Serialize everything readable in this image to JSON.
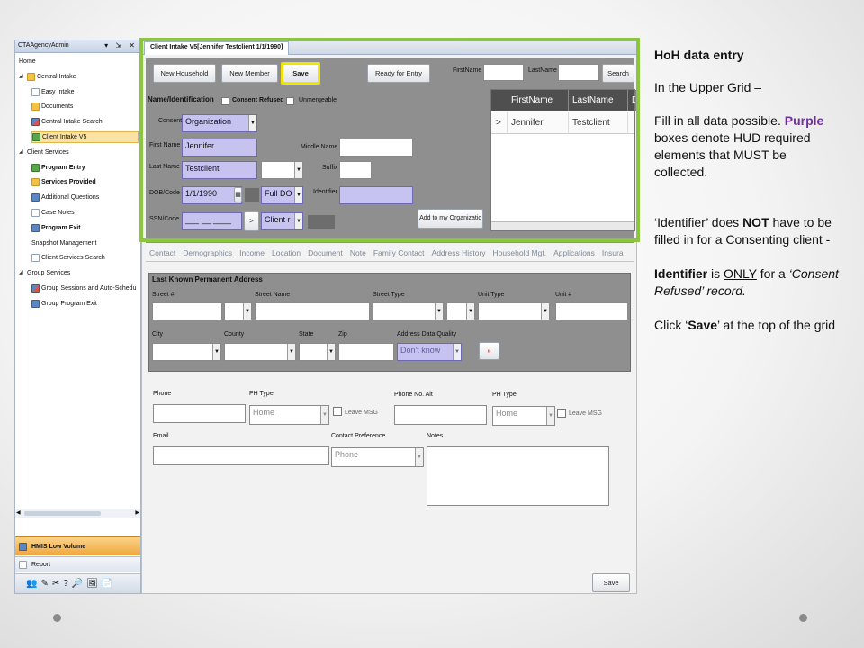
{
  "nav": {
    "title": "CTAAgencyAdmin",
    "controls": "▾ ⇲ ✕",
    "items": [
      {
        "label": "Home",
        "level": 0,
        "icon": "none",
        "bold": false
      },
      {
        "label": "Central Intake",
        "level": 0,
        "icon": "folder",
        "bold": false,
        "expanded": true
      },
      {
        "label": "Easy Intake",
        "level": 1,
        "icon": "page",
        "bold": false
      },
      {
        "label": "Documents",
        "level": 1,
        "icon": "folder",
        "bold": false
      },
      {
        "label": "Central Intake Search",
        "level": 1,
        "icon": "mixed",
        "bold": false
      },
      {
        "label": "Client Intake V5",
        "level": 1,
        "icon": "green",
        "bold": false,
        "selected": true
      },
      {
        "label": "Client Services",
        "level": 0,
        "icon": "none",
        "bold": false,
        "expanded": true
      },
      {
        "label": "Program Entry",
        "level": 1,
        "icon": "green",
        "bold": true
      },
      {
        "label": "Services Provided",
        "level": 1,
        "icon": "folder",
        "bold": true
      },
      {
        "label": "Additional Questions",
        "level": 1,
        "icon": "blue",
        "bold": false
      },
      {
        "label": "Case Notes",
        "level": 1,
        "icon": "page",
        "bold": false
      },
      {
        "label": "Program Exit",
        "level": 1,
        "icon": "blue",
        "bold": true
      },
      {
        "label": "Snapshot Management",
        "level": 1,
        "icon": "none",
        "bold": false
      },
      {
        "label": "Client Services Search",
        "level": 1,
        "icon": "page",
        "bold": false
      },
      {
        "label": "Group Services",
        "level": 0,
        "icon": "none",
        "bold": false,
        "expanded": true
      },
      {
        "label": "Group Sessions and Auto-Schedu",
        "level": 1,
        "icon": "mixed",
        "bold": false
      },
      {
        "label": "Group Program Exit",
        "level": 1,
        "icon": "blue",
        "bold": false
      }
    ],
    "bottom_buttons": [
      {
        "label": "HMIS Low Volume",
        "icon": "people-icon"
      },
      {
        "label": "Report",
        "icon": "report-icon"
      }
    ],
    "tool_icons": [
      "👥",
      "✎",
      "✂",
      "?",
      "🔎",
      "🖼",
      "📄"
    ]
  },
  "window": {
    "tab_title": "Client Intake V5[Jennifer Testclient 1/1/1990]",
    "toolbar": {
      "new_household": "New Household",
      "new_member": "New Member",
      "save": "Save",
      "ready_for_entry": "Ready for Entry",
      "firstname_label": "FirstName",
      "lastname_label": "LastName",
      "search": "Search"
    },
    "name_section": {
      "title": "Name/Identification",
      "consent_refused": "Consent Refused",
      "unmergeable": "Unmergeable",
      "consent_label": "Consent",
      "consent_value": "Organization",
      "first_name_label": "First Name",
      "first_name_value": "Jennifer",
      "middle_name_label": "Middle Name",
      "last_name_label": "Last Name",
      "last_name_value": "Testclient",
      "suffix_label": "Suffix",
      "dob_label": "DOB/Code",
      "dob_value": "1/1/1990",
      "dob_code_value": "Full DO",
      "identifier_label": "Identifier",
      "ssn_label": "SSN/Code",
      "ssn_value": "___-__-____",
      "ssn_arrow": ">",
      "ssn_code_value": "Client r",
      "add_to_org": "Add to my Organizatic"
    },
    "grid": {
      "columns": [
        "FirstName",
        "LastName",
        "DO"
      ],
      "rows": [
        {
          "arrow": ">",
          "first": "Jennifer",
          "last": "Testclient",
          "dob": ""
        }
      ]
    },
    "sub_tabs": [
      "Contact",
      "Demographics",
      "Income",
      "Location",
      "Document",
      "Note",
      "Family Contact",
      "Address History",
      "Household Mgt.",
      "Applications",
      "Insura"
    ],
    "address": {
      "title": "Last Known Permanent Address",
      "labels": [
        "Street #",
        "Street Name",
        "Street Type",
        "Unit Type",
        "Unit #",
        "City",
        "County",
        "State",
        "Zip",
        "Address Data Quality"
      ],
      "data_quality_value": "Don't know",
      "more_button": "»"
    },
    "contact": {
      "phone_label": "Phone",
      "ph_type_label": "PH Type",
      "ph_type_value": "Home",
      "leave_msg": "Leave MSG",
      "phone_alt_label": "Phone No. Alt",
      "ph_type2_label": "PH Type",
      "ph_type2_value": "Home",
      "leave_msg2": "Leave MSG",
      "email_label": "Email",
      "contact_pref_label": "Contact Preference",
      "contact_pref_value": "Phone",
      "notes_label": "Notes",
      "save": "Save"
    }
  },
  "instructions": {
    "title": "HoH data entry",
    "line1": "In the Upper Grid –",
    "p2_a": "Fill in all data possible.",
    "p2_purple": "Purple",
    "p2_b": "boxes denote HUD required elements that MUST be collected.",
    "p3_a": "‘Identifier’ does",
    "p3_not": "NOT",
    "p3_b": "have to be filled in for a Consenting client  -",
    "p4_identifier": "Identifier",
    "p4_is": "is",
    "p4_only": "ONLY",
    "p4_for": "for a",
    "p4_italic": "‘Consent Refused’ record.",
    "p5_a": "Click ‘",
    "p5_save": "Save",
    "p5_b": "’ at the top of the grid"
  },
  "colors": {
    "highlight_green": "#8cc640",
    "save_outline": "#f3e400",
    "required_purple": "#c6c3f1",
    "purple_text": "#7030a0"
  }
}
